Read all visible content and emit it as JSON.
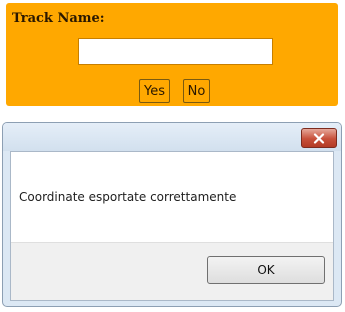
{
  "track_prompt": {
    "title": "Track Name:",
    "input_value": "",
    "yes_label": "Yes",
    "no_label": "No",
    "background_color": "#ffa800"
  },
  "message_dialog": {
    "message": "Coordinate esportate correttamente",
    "ok_label": "OK",
    "close_icon": "close-icon",
    "close_color": "#c7503a"
  }
}
